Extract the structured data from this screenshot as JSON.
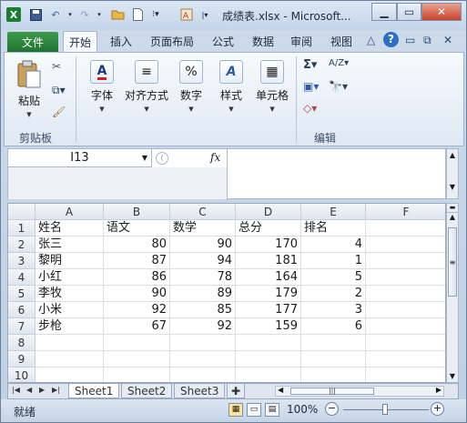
{
  "window": {
    "title": "成绩表.xlsx - Microsoft...",
    "app_icon": "X",
    "qat": [
      "save-icon",
      "undo-icon",
      "redo-icon",
      "open-folder-icon",
      "new-doc-icon",
      "customize-icon",
      "format-icon"
    ]
  },
  "ribbon_tabs": {
    "file": "文件",
    "tabs": [
      "开始",
      "插入",
      "页面布局",
      "公式",
      "数据",
      "审阅",
      "视图"
    ]
  },
  "ribbon": {
    "clipboard": {
      "paste": "粘贴",
      "group": "剪贴板"
    },
    "font": {
      "label": "字体",
      "icon_text": "A"
    },
    "alignment": {
      "label": "对齐方式",
      "icon_text": "≡"
    },
    "number": {
      "label": "数字",
      "icon_text": "%"
    },
    "styles": {
      "label": "样式",
      "icon_text": "A"
    },
    "cells": {
      "label": "单元格",
      "icon_text": "▦"
    },
    "editing": {
      "group": "编辑",
      "sum": "Σ",
      "sort": "A/Z",
      "find": "🔭",
      "clear": "◇"
    }
  },
  "formula_bar": {
    "name_box": "I13",
    "fx": "fx",
    "formula": ""
  },
  "grid": {
    "columns": [
      "A",
      "B",
      "C",
      "D",
      "E",
      "F"
    ],
    "rows": [
      {
        "n": "1",
        "cells": [
          "姓名",
          "语文",
          "数学",
          "总分",
          "排名",
          ""
        ]
      },
      {
        "n": "2",
        "cells": [
          "张三",
          "80",
          "90",
          "170",
          "4",
          ""
        ]
      },
      {
        "n": "3",
        "cells": [
          "黎明",
          "87",
          "94",
          "181",
          "1",
          ""
        ]
      },
      {
        "n": "4",
        "cells": [
          "小红",
          "86",
          "78",
          "164",
          "5",
          ""
        ]
      },
      {
        "n": "5",
        "cells": [
          "李牧",
          "90",
          "89",
          "179",
          "2",
          ""
        ]
      },
      {
        "n": "6",
        "cells": [
          "小米",
          "92",
          "85",
          "177",
          "3",
          ""
        ]
      },
      {
        "n": "7",
        "cells": [
          "步枪",
          "67",
          "92",
          "159",
          "6",
          ""
        ]
      },
      {
        "n": "8",
        "cells": [
          "",
          "",
          "",
          "",
          "",
          ""
        ]
      },
      {
        "n": "9",
        "cells": [
          "",
          "",
          "",
          "",
          "",
          ""
        ]
      },
      {
        "n": "10",
        "cells": [
          "",
          "",
          "",
          "",
          "",
          ""
        ]
      }
    ]
  },
  "sheets": {
    "tabs": [
      "Sheet1",
      "Sheet2",
      "Sheet3"
    ],
    "active": "Sheet1"
  },
  "status": {
    "ready": "就绪",
    "zoom": "100%"
  }
}
